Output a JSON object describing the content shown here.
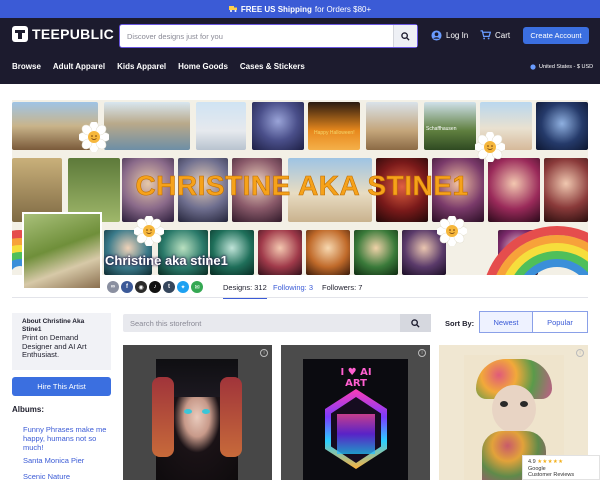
{
  "promo": {
    "icon": "truck-icon",
    "bold": "FREE US Shipping",
    "rest": "for Orders $80+"
  },
  "header": {
    "brand": "TEEPUBLIC",
    "search_placeholder": "Discover designs just for you",
    "login": "Log In",
    "cart": "Cart",
    "create_account": "Create Account",
    "nav": [
      "Browse",
      "Adult Apparel",
      "Kids Apparel",
      "Home Goods",
      "Cases & Stickers"
    ],
    "locale": "United States - $ USD"
  },
  "banner": {
    "title": "CHRISTINE AKA STINE1",
    "tile_labels": [
      "Happy Halloween!",
      "Schaffhausen"
    ]
  },
  "store": {
    "name": "Christine aka stine1",
    "stats": {
      "designs": "Designs: 312",
      "following": "Following: 3",
      "followers": "Followers: 7"
    },
    "socials": [
      "link-icon",
      "facebook-icon",
      "instagram-icon",
      "tiktok-icon",
      "tumblr-icon",
      "twitter-icon",
      "email-icon"
    ]
  },
  "sidebar": {
    "about_title": "About Christine Aka Stine1",
    "about_text": "Print on Demand Designer and AI Art Enthusiast.",
    "hire": "Hire This Artist",
    "albums_heading": "Albums:",
    "albums": [
      "Funny Phrases make me happy, humans not so much!",
      "Santa Monica Pier",
      "Scenic Nature"
    ]
  },
  "storefront": {
    "search_placeholder": "Search this storefront",
    "sort_label": "Sort By:",
    "sort_options": [
      "Newest",
      "Popular"
    ]
  },
  "products": [
    {
      "art_text": ""
    },
    {
      "art_text": "I ♥ AI ART"
    },
    {
      "art_text": ""
    }
  ],
  "reviews_badge": {
    "rating": "4.9",
    "stars": "★★★★★",
    "line1": "Google",
    "line2": "Customer Reviews"
  },
  "colors": {
    "header_bg": "#1c1b2e",
    "accent": "#3b6fe0",
    "promo": "#3b5bd6"
  }
}
